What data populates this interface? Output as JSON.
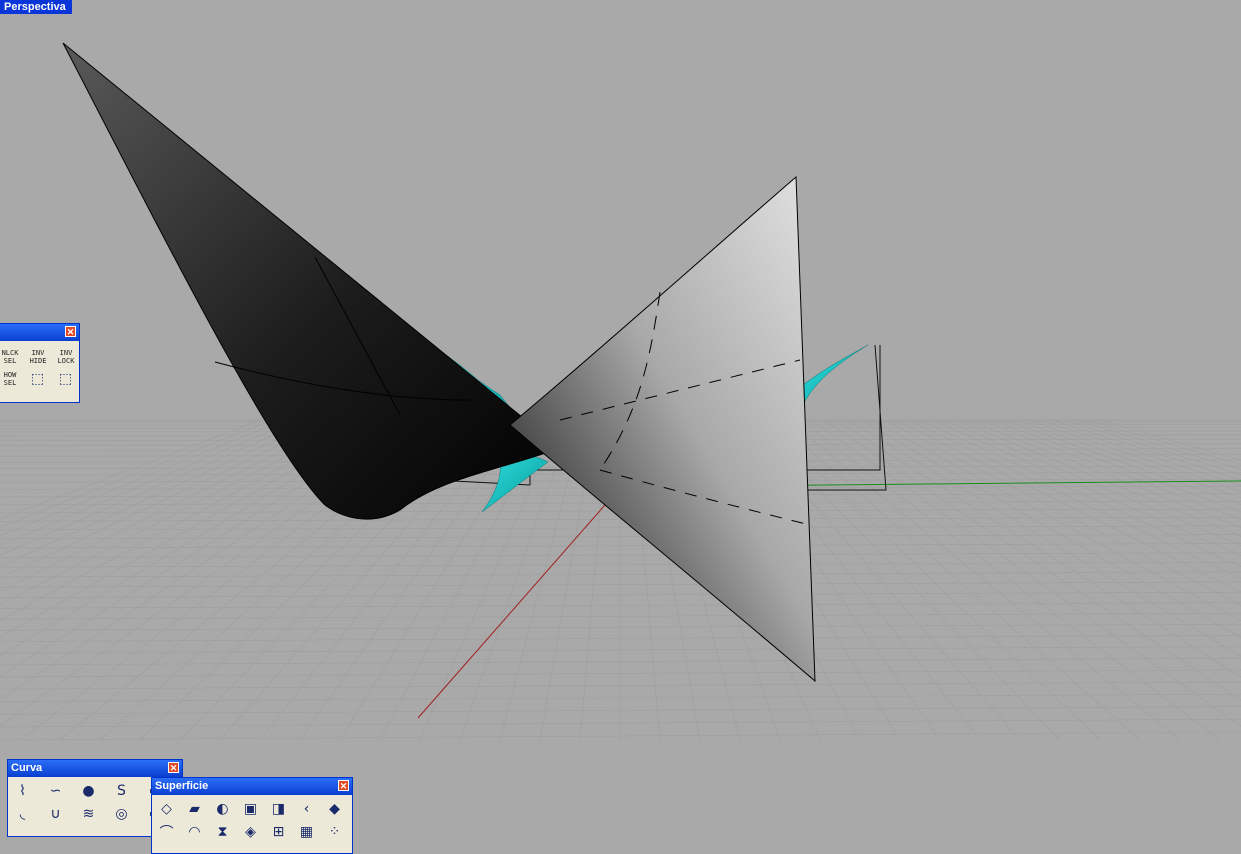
{
  "viewport": {
    "label": "Perspectiva",
    "background": "#a9a9a9",
    "grid_color": "#9e9e9e",
    "x_axis_color": "#a02020",
    "y_axis_color": "#1a8c1a"
  },
  "select_toolbar": {
    "items": [
      {
        "label": "NLCK\nSEL",
        "icon": "unlock-selected-icon"
      },
      {
        "label": "INV\nHIDE",
        "icon": "invert-hide-icon"
      },
      {
        "label": "INV\nLOCK",
        "icon": "invert-lock-icon"
      },
      {
        "label": "HOW\nSEL",
        "icon": "show-selected-icon"
      },
      {
        "label": "",
        "icon": "hide-selected-icon"
      },
      {
        "label": "",
        "icon": "lock-selected-icon"
      }
    ]
  },
  "curva_toolbar": {
    "title": "Curva",
    "icons": [
      "polyline-icon",
      "curve-icon",
      "sphere-icon",
      "freeform-curve-icon",
      "control-point-curve-icon",
      "arc-icon",
      "interpolate-curve-icon",
      "helix-icon",
      "spiral-icon",
      "conic-icon"
    ]
  },
  "superficie_toolbar": {
    "title": "Superficie",
    "icons": [
      "surface-from-points-icon",
      "edge-surface-icon",
      "revolve-icon",
      "plane-icon",
      "extrude-surface-icon",
      "loft-icon",
      "patch-icon",
      "sweep-icon",
      "network-icon",
      "rail-revolve-icon",
      "blend-icon",
      "grid-surface-icon",
      "quad-surface-icon",
      "point-grid-icon"
    ]
  },
  "colors": {
    "title_bar": "#0a3fd0",
    "toolbar_bg": "#ece9d8",
    "surface_cyan": "#19c8c8"
  }
}
